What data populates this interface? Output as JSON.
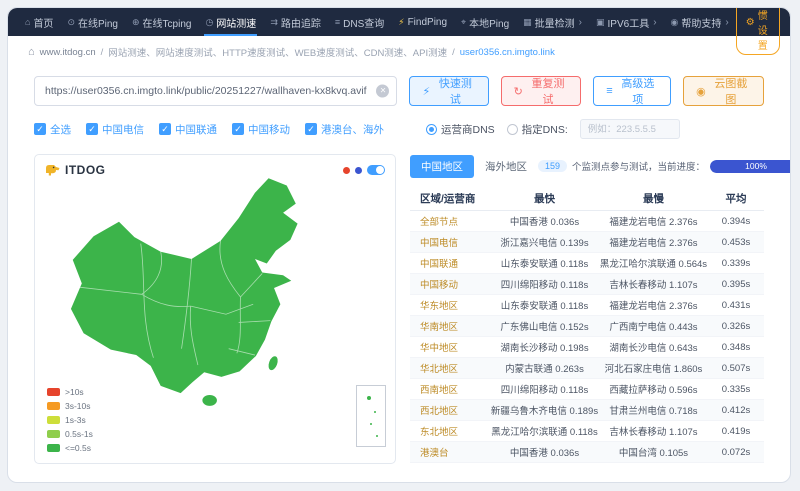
{
  "colors": {
    "accent": "#409eff",
    "danger": "#f56c6c",
    "warning": "#e6a23c",
    "nav_bg": "#1f2a40",
    "settings": "#f5a623",
    "progress": "#3b55d0",
    "map_green": "#3cb44a",
    "region": "#bd8b26"
  },
  "brand": {
    "logo_text": "ITDOG"
  },
  "nav": {
    "items": [
      {
        "key": "home",
        "label": "首页"
      },
      {
        "key": "online-ping",
        "label": "在线Ping"
      },
      {
        "key": "online-tcping",
        "label": "在线Tcping"
      },
      {
        "key": "website-speed",
        "label": "网站测速",
        "active": true
      },
      {
        "key": "route-trace",
        "label": "路由追踪"
      },
      {
        "key": "dns-query",
        "label": "DNS查询"
      },
      {
        "key": "findping",
        "label": "FindPing"
      },
      {
        "key": "local-ping",
        "label": "本地Ping"
      },
      {
        "key": "batch-test",
        "label": "批量检测",
        "chevron": true
      },
      {
        "key": "ipv6-tools",
        "label": "IPV6工具",
        "chevron": true
      },
      {
        "key": "help-support",
        "label": "帮助支持",
        "chevron": true
      }
    ],
    "settings": "习惯设置"
  },
  "breadcrumb": {
    "site": "www.itdog.cn",
    "separator": "/",
    "path": "网站测速、网站速度测试、HTTP速度测试、WEB速度测试、CDN测速、API测速",
    "current": "user0356.cn.imgto.link"
  },
  "test": {
    "url_value": "https://user0356.cn.imgto.link/public/20251227/wallhaven-kx8kvq.avif",
    "buttons": {
      "quick": "快速测试",
      "repeat": "重复测试",
      "advanced": "高级选项",
      "screenshot": "云图截图"
    }
  },
  "filters": {
    "checkboxes": [
      {
        "key": "select-all",
        "label": "全选",
        "checked": true
      },
      {
        "key": "china-telecom",
        "label": "中国电信",
        "checked": true
      },
      {
        "key": "china-unicom",
        "label": "中国联通",
        "checked": true
      },
      {
        "key": "china-mobile",
        "label": "中国移动",
        "checked": true
      },
      {
        "key": "hmt-overseas",
        "label": "港澳台、海外",
        "checked": true
      }
    ],
    "radios": [
      {
        "key": "operator-dns",
        "label": "运营商DNS",
        "selected": true
      },
      {
        "key": "custom-dns",
        "label": "指定DNS:",
        "selected": false
      }
    ],
    "dns_placeholder": "例如：223.5.5.5"
  },
  "map": {
    "legend": [
      {
        "key": "gt-10s",
        "label": ">10s",
        "color": "#e6442c"
      },
      {
        "key": "3s-10s",
        "label": "3s-10s",
        "color": "#f59a23"
      },
      {
        "key": "1s-3s",
        "label": "1s-3s",
        "color": "#cdde3a"
      },
      {
        "key": "05s-1s",
        "label": "0.5s-1s",
        "color": "#8fce4c"
      },
      {
        "key": "lte-05s",
        "label": "<=0.5s",
        "color": "#3cb44a"
      }
    ]
  },
  "results": {
    "tabs": [
      {
        "label": "中国地区",
        "active": true
      },
      {
        "label": "海外地区",
        "active": false
      }
    ],
    "monitor_count": "159",
    "progress_text": "个监测点参与测试，当前进度：",
    "progress_value": "100%",
    "table": {
      "headers": [
        "区域/运营商",
        "最快",
        "最慢",
        "平均"
      ],
      "rows": [
        {
          "region": "全部节点",
          "fastest": "中国香港 0.036s",
          "slowest": "福建龙岩电信 2.376s",
          "avg": "0.394s"
        },
        {
          "region": "中国电信",
          "fastest": "浙江嘉兴电信 0.139s",
          "slowest": "福建龙岩电信 2.376s",
          "avg": "0.453s"
        },
        {
          "region": "中国联通",
          "fastest": "山东泰安联通 0.118s",
          "slowest": "黑龙江哈尔滨联通 0.564s",
          "avg": "0.339s"
        },
        {
          "region": "中国移动",
          "fastest": "四川绵阳移动 0.118s",
          "slowest": "吉林长春移动 1.107s",
          "avg": "0.395s"
        },
        {
          "region": "华东地区",
          "fastest": "山东泰安联通 0.118s",
          "slowest": "福建龙岩电信 2.376s",
          "avg": "0.431s"
        },
        {
          "region": "华南地区",
          "fastest": "广东佛山电信 0.152s",
          "slowest": "广西南宁电信 0.443s",
          "avg": "0.326s"
        },
        {
          "region": "华中地区",
          "fastest": "湖南长沙移动 0.198s",
          "slowest": "湖南长沙电信 0.643s",
          "avg": "0.348s"
        },
        {
          "region": "华北地区",
          "fastest": "内蒙古联通 0.263s",
          "slowest": "河北石家庄电信 1.860s",
          "avg": "0.507s"
        },
        {
          "region": "西南地区",
          "fastest": "四川绵阳移动 0.118s",
          "slowest": "西藏拉萨移动 0.596s",
          "avg": "0.335s"
        },
        {
          "region": "西北地区",
          "fastest": "新疆乌鲁木齐电信 0.189s",
          "slowest": "甘肃兰州电信 0.718s",
          "avg": "0.412s"
        },
        {
          "region": "东北地区",
          "fastest": "黑龙江哈尔滨联通 0.118s",
          "slowest": "吉林长春移动 1.107s",
          "avg": "0.419s"
        },
        {
          "region": "港澳台",
          "fastest": "中国香港 0.036s",
          "slowest": "中国台湾 0.105s",
          "avg": "0.072s"
        }
      ]
    }
  }
}
